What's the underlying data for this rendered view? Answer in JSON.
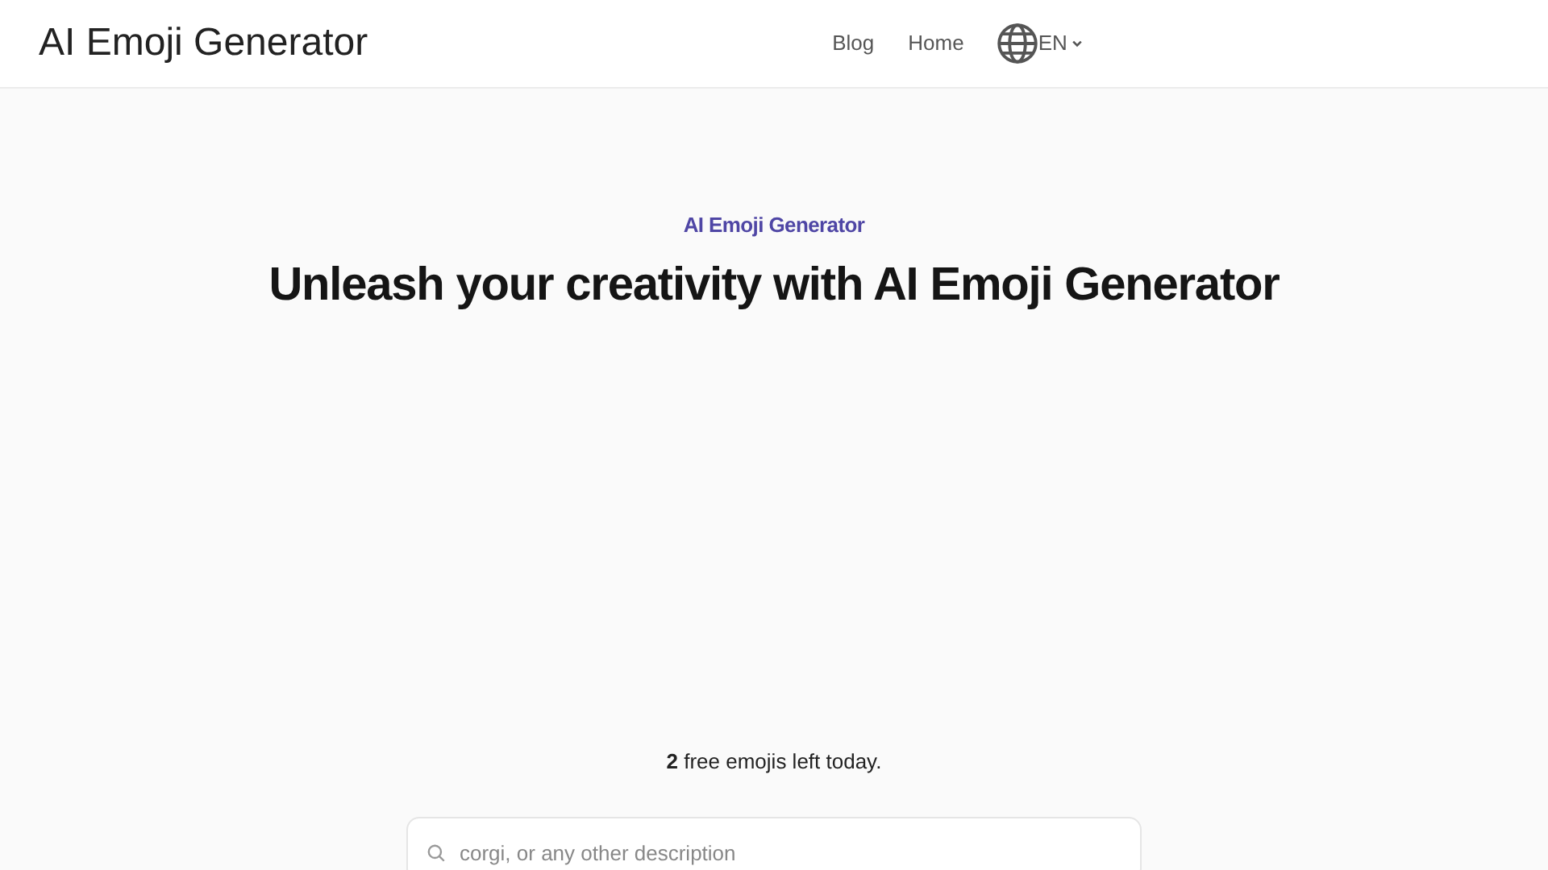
{
  "header": {
    "logo": "AI Emoji Generator",
    "nav": [
      {
        "label": "Blog"
      },
      {
        "label": "Home"
      }
    ],
    "language": "EN"
  },
  "hero": {
    "eyebrow": "AI Emoji Generator",
    "title": "Unleash your creativity with AI Emoji Generator"
  },
  "quota": "**2** free emojis left today.",
  "search": {
    "placeholder": "corgi, or any other description"
  }
}
